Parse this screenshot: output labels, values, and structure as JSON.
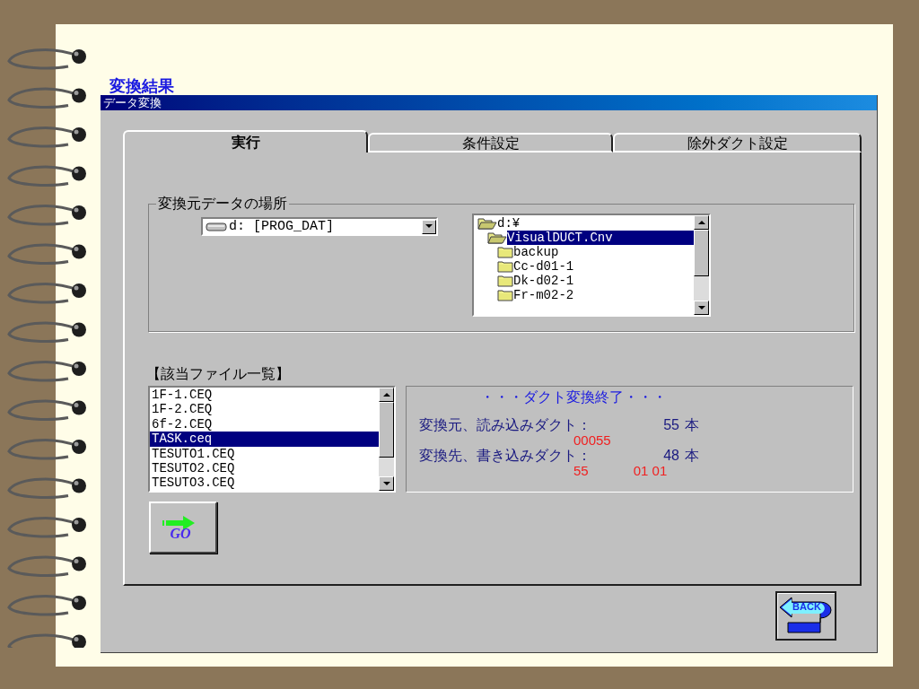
{
  "page_title": "変換結果",
  "window": {
    "title": "データ変換"
  },
  "tabs": [
    {
      "label": "実行",
      "selected": true
    },
    {
      "label": "条件設定",
      "selected": false
    },
    {
      "label": "除外ダクト設定",
      "selected": false
    }
  ],
  "source_group": {
    "title": "変換元データの場所",
    "drive_combo": {
      "value": "d: [PROG_DAT]"
    },
    "folder_tree": [
      {
        "label": "d:¥",
        "kind": "open-folder",
        "selected": false,
        "children": [
          {
            "label": "VisualDUCT.Cnv",
            "kind": "open-folder",
            "selected": true,
            "children": [
              {
                "label": "backup",
                "kind": "folder",
                "selected": false
              },
              {
                "label": "Cc-d01-1",
                "kind": "folder",
                "selected": false
              },
              {
                "label": "Dk-d02-1",
                "kind": "folder",
                "selected": false
              },
              {
                "label": "Fr-m02-2",
                "kind": "folder",
                "selected": false
              }
            ]
          }
        ]
      }
    ]
  },
  "file_list": {
    "title": "【該当ファイル一覧】",
    "items": [
      {
        "label": "1F-1.CEQ",
        "selected": false
      },
      {
        "label": "1F-2.CEQ",
        "selected": false
      },
      {
        "label": "6f-2.CEQ",
        "selected": false
      },
      {
        "label": "TASK.ceq",
        "selected": true
      },
      {
        "label": "TESUTO1.CEQ",
        "selected": false
      },
      {
        "label": "TESUTO2.CEQ",
        "selected": false
      },
      {
        "label": "TESUTO3.CEQ",
        "selected": false
      }
    ]
  },
  "result": {
    "heading": "・・・ダクト変換終了・・・",
    "rows": [
      {
        "label": "変換元、読み込みダクト：",
        "count": "55",
        "unit": "本",
        "details": [
          "00055"
        ]
      },
      {
        "label": "変換先、書き込みダクト：",
        "count": "48",
        "unit": "本",
        "details": [
          "55",
          "01 01"
        ]
      }
    ]
  },
  "go_button": {
    "label": "GO"
  },
  "back_button": {
    "label": "BACK"
  }
}
